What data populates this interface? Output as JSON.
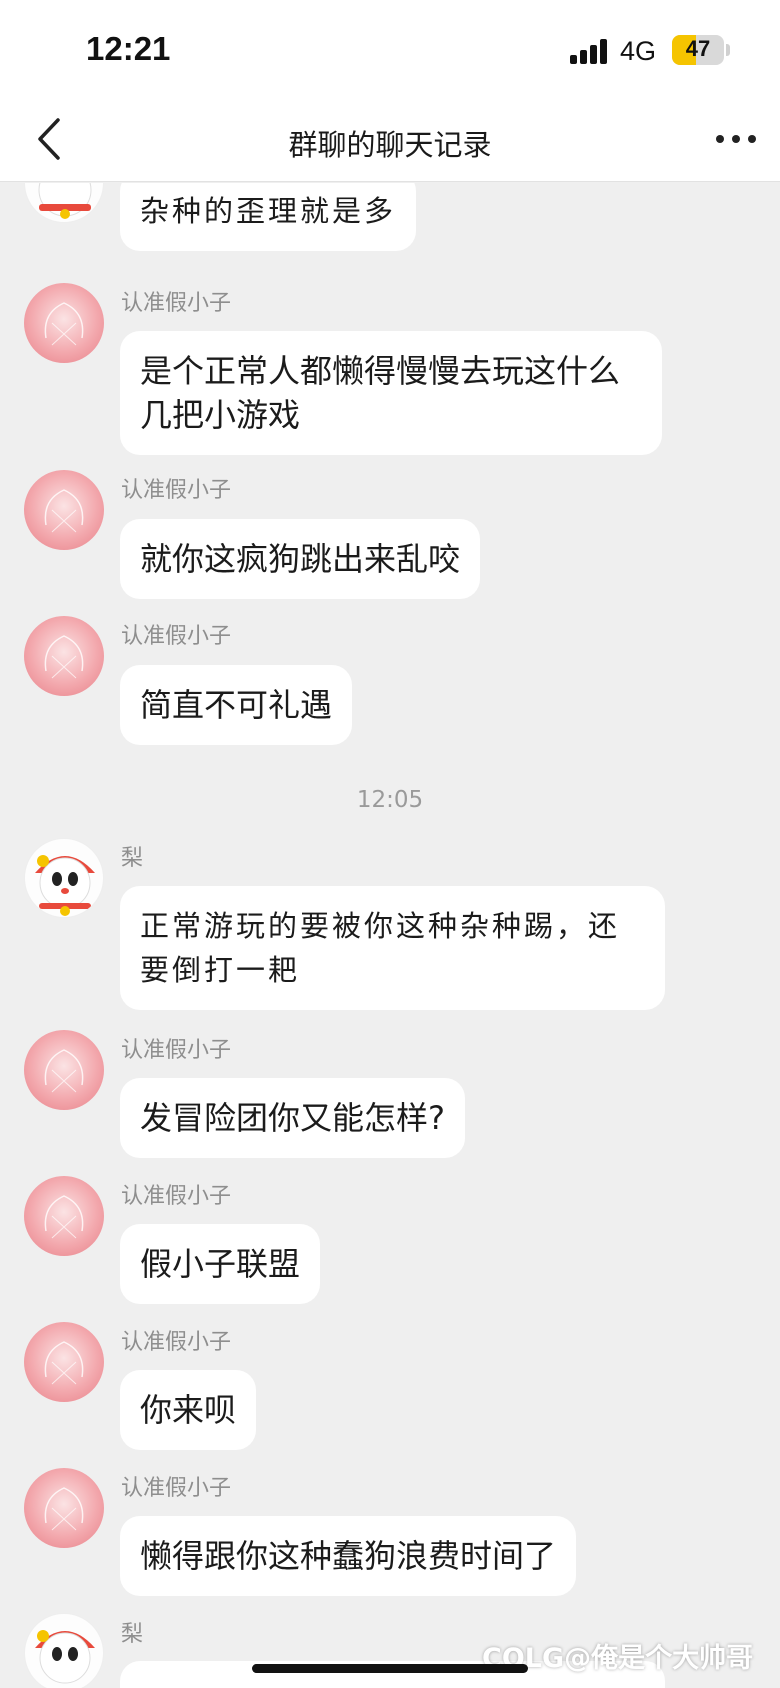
{
  "status_bar": {
    "time": "12:21",
    "network": "4G",
    "battery_percent": "47",
    "battery_level": 0.47,
    "battery_color": "#f5c400"
  },
  "navbar": {
    "title": "群聊的聊天记录",
    "back_icon": "chevron-left-icon",
    "more_icon": "more-horizontal-icon"
  },
  "messages": [
    {
      "sender": "",
      "avatar": "cartoon-cat-avatar",
      "text": "杂种的歪理就是多"
    },
    {
      "sender": "认准假小子",
      "avatar": "pink-avatar",
      "text": "是个正常人都懒得慢慢去玩这什么几把小游戏"
    },
    {
      "sender": "认准假小子",
      "avatar": "pink-avatar",
      "text": "就你这疯狗跳出来乱咬"
    },
    {
      "sender": "认准假小子",
      "avatar": "pink-avatar",
      "text": "简直不可礼遇"
    },
    {
      "timestamp": "12:05"
    },
    {
      "sender": "梨",
      "avatar": "cartoon-cat-avatar",
      "text": "正常游玩的要被你这种杂种踢，还要倒打一耙"
    },
    {
      "sender": "认准假小子",
      "avatar": "pink-avatar",
      "text": "发冒险团你又能怎样?"
    },
    {
      "sender": "认准假小子",
      "avatar": "pink-avatar",
      "text": "假小子联盟"
    },
    {
      "sender": "认准假小子",
      "avatar": "pink-avatar",
      "text": "你来呗"
    },
    {
      "sender": "认准假小子",
      "avatar": "pink-avatar",
      "text": "懒得跟你这种蠢狗浪费时间了"
    },
    {
      "sender": "梨",
      "avatar": "cartoon-cat-avatar",
      "text": ""
    }
  ],
  "watermark": "COLG@俺是个大帅哥"
}
